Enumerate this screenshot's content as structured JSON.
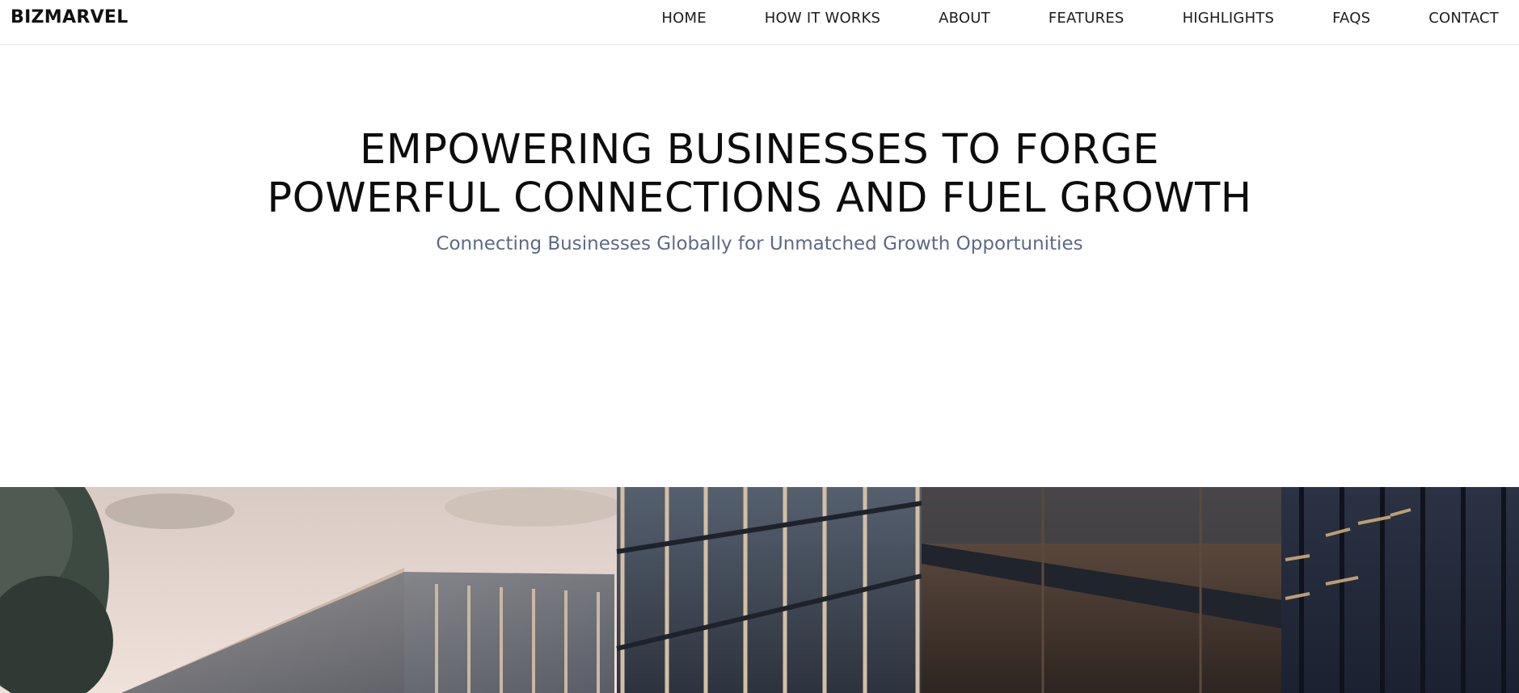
{
  "brand": {
    "name": "BIZMARVEL"
  },
  "nav": {
    "items": [
      {
        "label": "HOME"
      },
      {
        "label": "HOW IT WORKS"
      },
      {
        "label": "ABOUT"
      },
      {
        "label": "FEATURES"
      },
      {
        "label": "HIGHLIGHTS"
      },
      {
        "label": "FAQS"
      },
      {
        "label": "CONTACT"
      }
    ]
  },
  "hero": {
    "title_line_1": "EMPOWERING BUSINESSES TO FORGE",
    "title_line_2": "POWERFUL CONNECTIONS AND FUEL GROWTH",
    "subtitle": "Connecting Businesses Globally for Unmatched Growth Opportunities"
  },
  "colors": {
    "text_primary": "#0d0d0d",
    "subtitle": "#5d6a86",
    "nav_border": "#e6e6e6",
    "background": "#ffffff"
  },
  "image": {
    "subject": "modern-glass-office-buildings-photo"
  }
}
